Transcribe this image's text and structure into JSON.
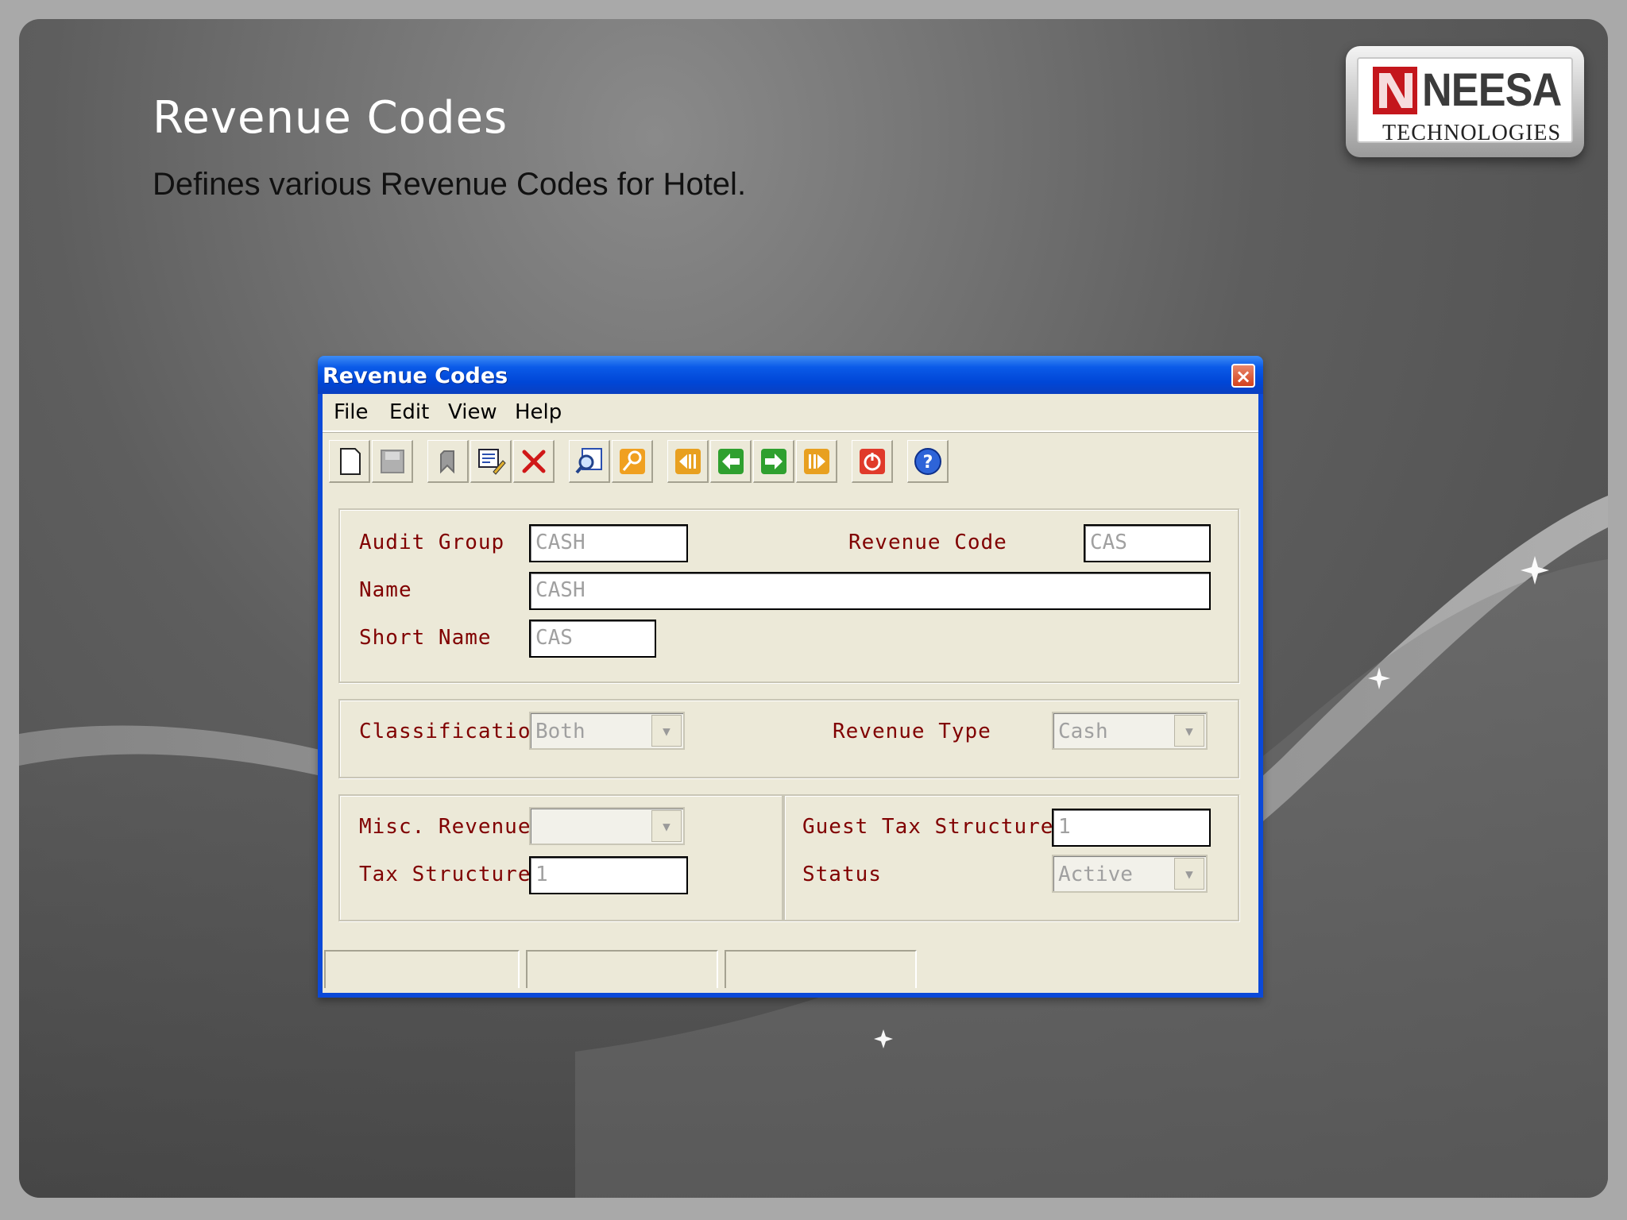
{
  "slide": {
    "title": "Revenue Codes",
    "subtitle": "Defines various Revenue Codes for Hotel.",
    "logo_word": "NEESA",
    "logo_tagline": "TECHNOLOGIES"
  },
  "window": {
    "title": "Revenue Codes",
    "close_glyph": "×"
  },
  "menu": [
    "File",
    "Edit",
    "View",
    "Help"
  ],
  "toolbar": {
    "buttons": [
      "new-icon",
      "save-icon",
      "undo-icon",
      "edit-icon",
      "delete-icon",
      "find-icon",
      "search-key-icon",
      "first-record-icon",
      "previous-record-icon",
      "next-record-icon",
      "last-record-icon",
      "exit-icon",
      "help-icon"
    ]
  },
  "form": {
    "audit_group_label": "Audit Group",
    "audit_group_value": "CASH",
    "revenue_code_label": "Revenue Code",
    "revenue_code_value": "CAS",
    "name_label": "Name",
    "name_value": "CASH",
    "short_name_label": "Short Name",
    "short_name_value": "CAS",
    "classification_label": "Classification",
    "classification_value": "Both",
    "revenue_type_label": "Revenue Type",
    "revenue_type_value": "Cash",
    "misc_revenue_label": "Misc. Revenue",
    "misc_revenue_value": "",
    "tax_structure_label": "Tax Structure",
    "tax_structure_value": "1",
    "guest_tax_structure_label": "Guest Tax Structure",
    "guest_tax_structure_value": "1",
    "status_label": "Status",
    "status_value": "Active"
  },
  "colors": {
    "label": "#800000",
    "window_face": "#ece9d8",
    "titlebar": "#0a5ae8"
  }
}
